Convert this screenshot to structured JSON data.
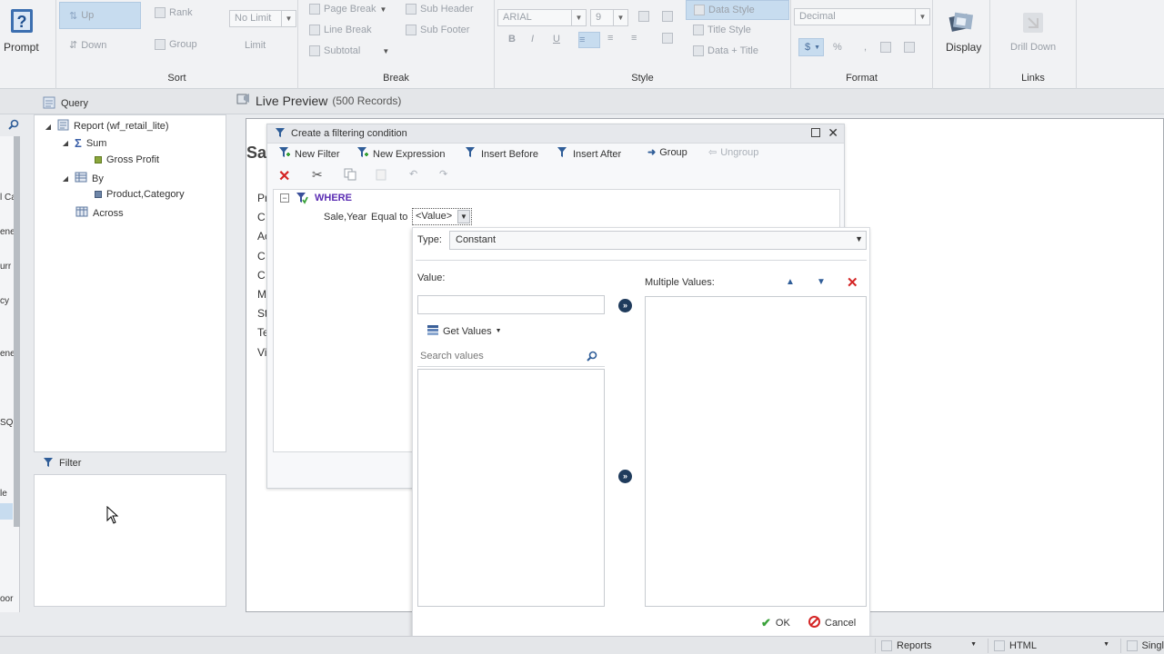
{
  "ribbon": {
    "prompt_label": "Prompt",
    "sort": {
      "up_label": "Up",
      "down_label": "Down",
      "rank_label": "Rank",
      "group_label": "Group",
      "limit_value": "No Limit",
      "limit_label": "Limit",
      "group_title": "Sort"
    },
    "break": {
      "page_break": "Page Break",
      "line_break": "Line Break",
      "subtotal": "Subtotal",
      "sub_header": "Sub Header",
      "sub_footer": "Sub Footer",
      "group_title": "Break"
    },
    "style": {
      "font_value": "ARIAL",
      "size_value": "9",
      "data_style": "Data Style",
      "title_style": "Title Style",
      "data_title": "Data + Title",
      "bold": "B",
      "italic": "I",
      "underline": "U",
      "group_title": "Style"
    },
    "format": {
      "format_value": "Decimal",
      "currency": "$",
      "percent": "%",
      "comma": ",",
      "group_title": "Format"
    },
    "display_label": "Display",
    "links": {
      "drill_down": "Drill Down",
      "group_title": "Links"
    }
  },
  "left_strip": [
    "l Ca",
    "ene",
    "urr",
    "cy",
    "ene",
    "SQ",
    "le",
    "oor"
  ],
  "query_panel": {
    "title": "Query",
    "items": [
      {
        "label": "Report (wf_retail_lite)"
      },
      {
        "label": "Sum"
      },
      {
        "label": "Gross Profit"
      },
      {
        "label": "By"
      },
      {
        "label": "Product,Category"
      },
      {
        "label": "Across"
      }
    ]
  },
  "filter_panel": {
    "title": "Filter"
  },
  "preview": {
    "title": "Live Preview",
    "records": "(500 Records)",
    "heading_partial": "Sa",
    "row_prefixes": [
      "Pr",
      "C",
      "Ac",
      "C",
      "C",
      "M",
      "St",
      "Te",
      "Vi"
    ]
  },
  "dialog": {
    "title": "Create a filtering condition",
    "toolbar": {
      "new_filter": "New Filter",
      "new_expression": "New Expression",
      "insert_before": "Insert Before",
      "insert_after": "Insert After",
      "group": "Group",
      "ungroup": "Ungroup"
    },
    "where_label": "WHERE",
    "condition": {
      "field": "Sale,Year",
      "operator": "Equal to",
      "value": "<Value>"
    }
  },
  "value_popup": {
    "type_label": "Type:",
    "type_value": "Constant",
    "value_label": "Value:",
    "value_input": "",
    "get_values": "Get Values",
    "search_placeholder": "Search values",
    "multiple_values_label": "Multiple Values:",
    "ok_label": "OK",
    "cancel_label": "Cancel"
  },
  "statusbar": {
    "reports": "Reports",
    "html": "HTML",
    "single_partial": "Singl"
  },
  "colors": {
    "accent_blue": "#1f5fa8",
    "where_purple": "#5b2db3",
    "delete_red": "#d42424",
    "dark_circle": "#1f3b5c"
  }
}
